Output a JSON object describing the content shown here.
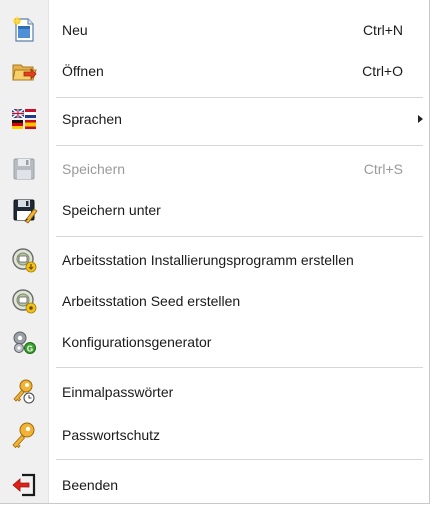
{
  "menu": {
    "items": [
      {
        "label": "Neu",
        "shortcut": "Ctrl+N",
        "icon": "new-document-icon"
      },
      {
        "label": "Öffnen",
        "shortcut": "Ctrl+O",
        "icon": "open-folder-icon"
      },
      {
        "label": "Sprachen",
        "shortcut": "",
        "icon": "language-flags-icon",
        "submenu": true
      },
      {
        "label": "Speichern",
        "shortcut": "Ctrl+S",
        "icon": "save-disk-icon",
        "disabled": true
      },
      {
        "label": "Speichern unter",
        "shortcut": "",
        "icon": "save-as-icon"
      },
      {
        "label": "Arbeitsstation Installierungsprogramm erstellen",
        "shortcut": "",
        "icon": "workstation-installer-icon"
      },
      {
        "label": "Arbeitsstation Seed erstellen",
        "shortcut": "",
        "icon": "workstation-seed-icon"
      },
      {
        "label": "Konfigurationsgenerator",
        "shortcut": "",
        "icon": "config-generator-gears-icon"
      },
      {
        "label": "Einmalpasswörter",
        "shortcut": "",
        "icon": "one-time-password-key-icon"
      },
      {
        "label": "Passwortschutz",
        "shortcut": "",
        "icon": "password-key-icon"
      },
      {
        "label": "Beenden",
        "shortcut": "",
        "icon": "exit-icon"
      }
    ]
  },
  "colors": {
    "gutter": "#f0f0f0",
    "text": "#1a1a1a",
    "disabled_text": "#9a9a9a",
    "separator": "#d6d6d6"
  }
}
